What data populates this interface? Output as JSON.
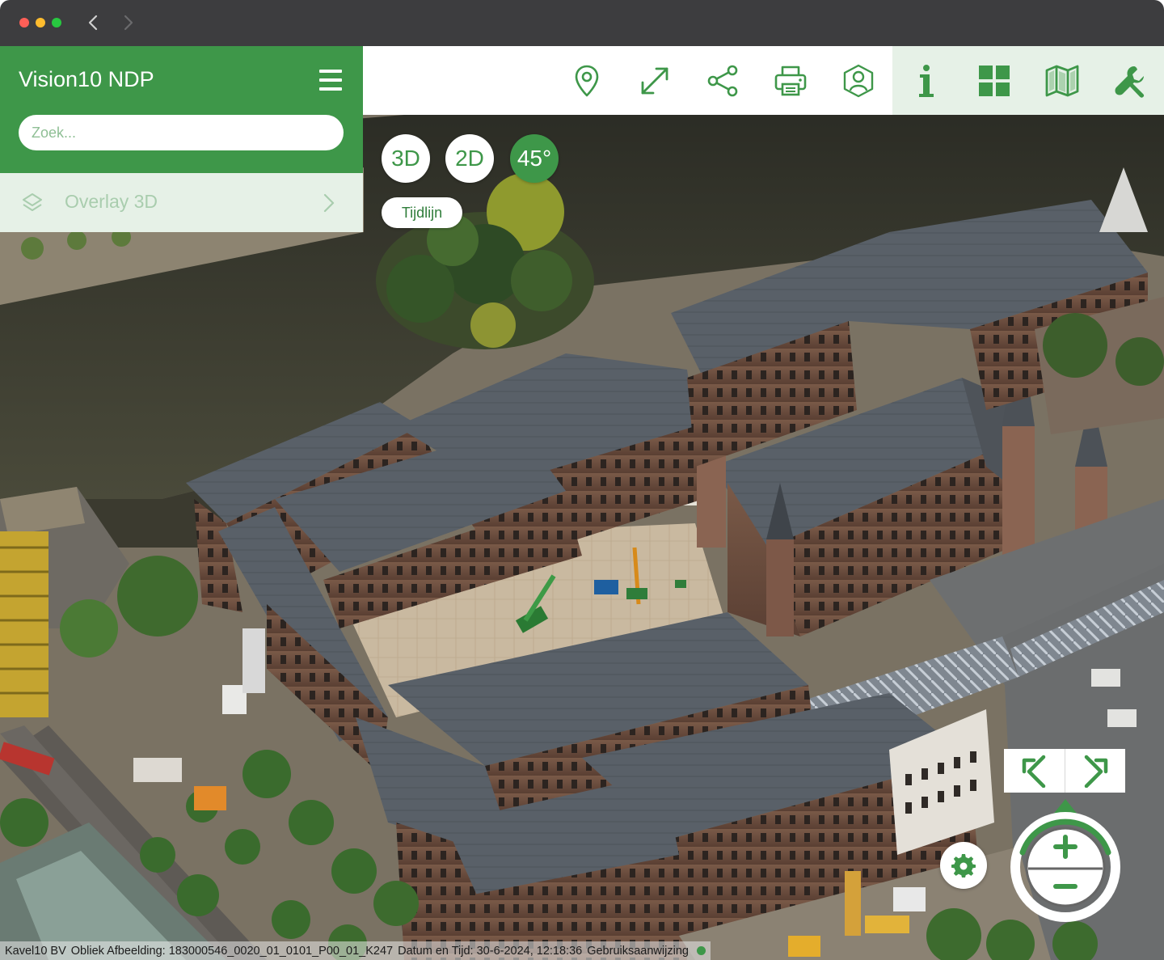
{
  "app": {
    "title": "Vision10 NDP"
  },
  "search": {
    "placeholder": "Zoek..."
  },
  "overlay": {
    "label": "Overlay 3D"
  },
  "view_modes": {
    "three_d": "3D",
    "two_d": "2D",
    "oblique": "45°",
    "active": "45°"
  },
  "timeline": {
    "label": "Tijdlijn"
  },
  "toolbar": {
    "icons": [
      "location-pin-icon",
      "expand-arrow-icon",
      "share-icon",
      "print-icon",
      "user-shield-icon",
      "info-icon",
      "grid-icon",
      "map-icon",
      "wrench-icon"
    ]
  },
  "status": {
    "company": "Kavel10 BV",
    "image": "Obliek Afbeelding: 183000546_0020_01_0101_P00_01_K247",
    "datetime": "Datum en Tijd: 30-6-2024, 12:18:36",
    "help": "Gebruiksaanwijzing"
  },
  "colors": {
    "brand_green": "#3e9749",
    "tint_green": "#e6f1e7",
    "panel_text_muted": "#a9cdae"
  }
}
